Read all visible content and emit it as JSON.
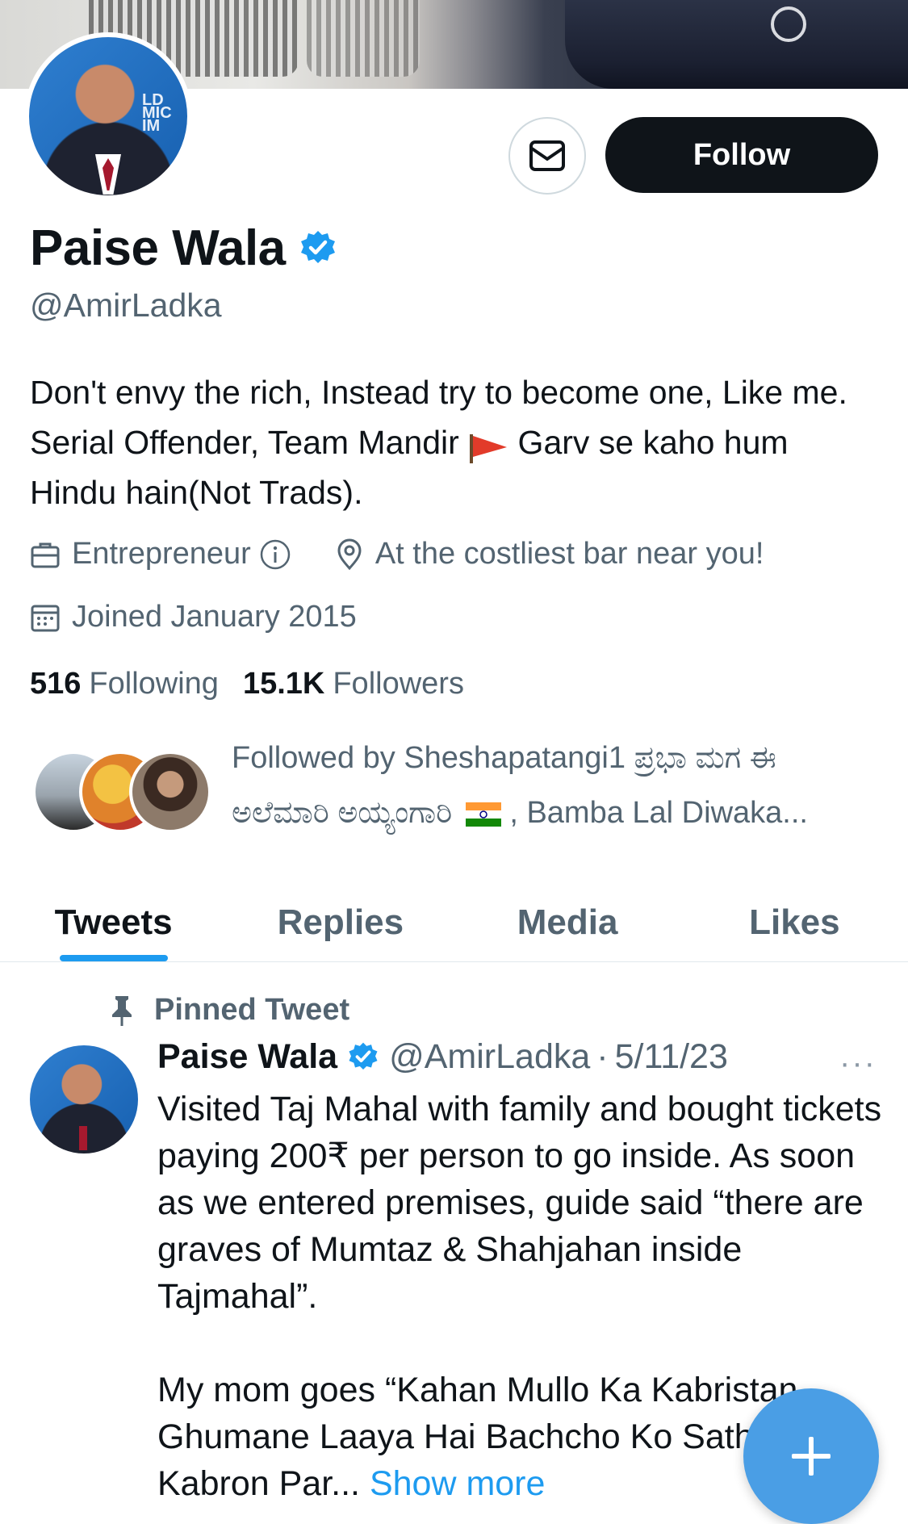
{
  "profile": {
    "name": "Paise Wala",
    "handle": "@AmirLadka",
    "bio_part1": "Don't envy the rich, Instead try to become one, Like me. Serial Offender, Team Mandir ",
    "bio_part2": " Garv se kaho hum Hindu hain(Not Trads).",
    "category": "Entrepreneur",
    "location": "At the costliest bar near you!",
    "joined": "Joined January 2015"
  },
  "actions": {
    "follow_label": "Follow"
  },
  "stats": {
    "following_count": "516",
    "following_label": "Following",
    "followers_count": "15.1K",
    "followers_label": "Followers"
  },
  "followed_by": {
    "line1": "Followed by Sheshapatangi1 ಪ್ರಭಾ ಮಗ ಈ",
    "line2a": "ಅಲೆಮಾರಿ ಅಯ್ಯಂಗಾರಿ",
    "line2b": " , Bamba Lal Diwaka..."
  },
  "tabs": [
    {
      "label": "Tweets"
    },
    {
      "label": "Replies"
    },
    {
      "label": "Media"
    },
    {
      "label": "Likes"
    }
  ],
  "tweet": {
    "pinned_label": "Pinned Tweet",
    "author_name": "Paise Wala",
    "author_handle": "@AmirLadka",
    "separator": "·",
    "date": "5/11/23",
    "more": "···",
    "text": "Visited Taj Mahal with family and bought tickets paying 200₹ per person to go inside. As soon as we entered premises, guide said “there are graves of Mumtaz & Shahjahan inside Tajmahal”.\n\nMy mom goes “Kahan Mullo Ka Kabristan Ghumane Laaya Hai Bachcho Ko Sath Lekar, Kabron Par... ",
    "show_more": "Show more"
  },
  "colors": {
    "accent": "#1d9bf0",
    "text_primary": "#0f1419",
    "text_secondary": "#536471",
    "fab": "#4a9ee5"
  }
}
